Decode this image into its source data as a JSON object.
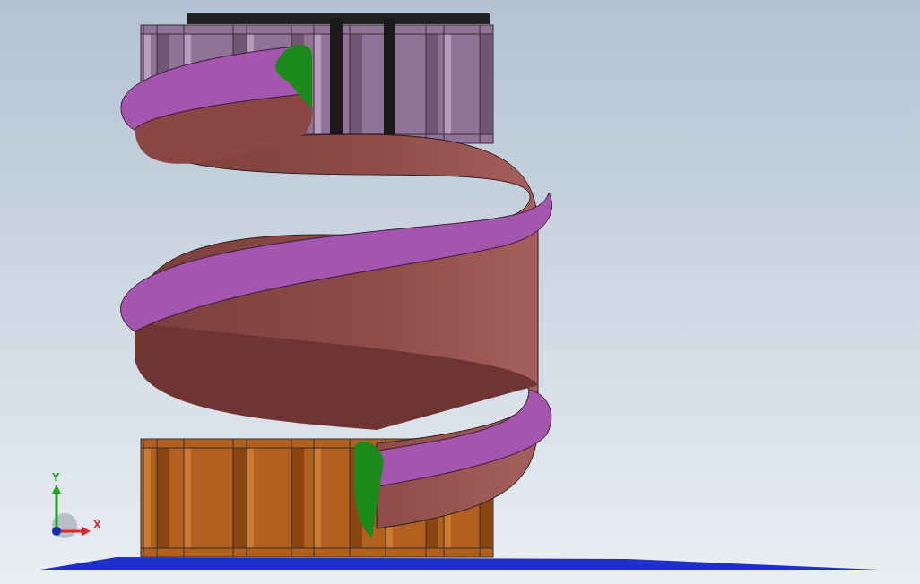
{
  "viewport": {
    "triad": {
      "axes": [
        {
          "label": "Y",
          "kind": "vertical",
          "color": "#1fa51f"
        },
        {
          "label": "X",
          "kind": "horizontal",
          "color": "#d42a2a"
        }
      ]
    }
  }
}
